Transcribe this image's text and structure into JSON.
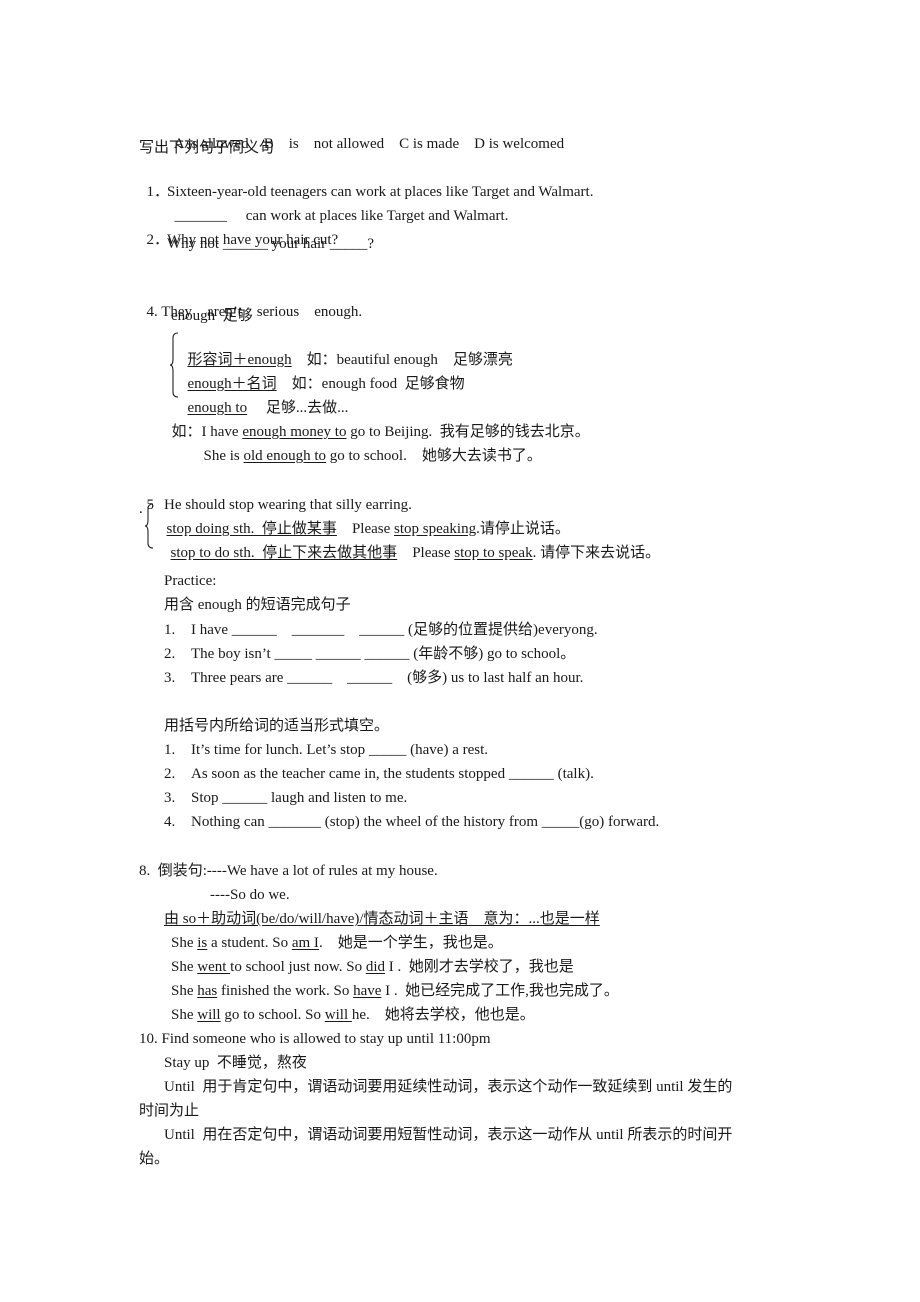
{
  "options_line": {
    "a": "A is allowed",
    "b": "B",
    "b2": "is",
    "b3": "not allowed",
    "c": "C is made",
    "d": "D is welcomed"
  },
  "synonym_section": {
    "heading": "写出下列句子同义句",
    "items": [
      {
        "num": "1．",
        "text": "Sixteen-year-old teenagers can work at places like Target and Walmart.",
        "answer_prefix": "_______",
        "answer": "can work at places like Target and Walmart."
      },
      {
        "num": "2．",
        "text": "Why not have your hair cut?",
        "answer": "Why not ______ your hair _____?"
      }
    ]
  },
  "section4": {
    "title_parts": [
      "4. They",
      "aren’t",
      "serious",
      "enough."
    ],
    "enough_label": "enough  足够",
    "rules": [
      {
        "pattern": "形容词＋enough",
        "example_label": "如：beautiful enough",
        "meaning": "足够漂亮"
      },
      {
        "pattern": "enough＋名词",
        "example_label": "如：enough food",
        "meaning": "足够食物"
      },
      {
        "pattern": "enough to",
        "example_label": "",
        "meaning": "足够...去做..."
      }
    ],
    "example1": {
      "prefix": "如：I have ",
      "underlined": "enough money to",
      "suffix": " go to Beijing.  我有足够的钱去北京。"
    },
    "example2": {
      "prefix": "She is ",
      "underlined": "old enough to",
      "suffix": " go to school.    她够大去读书了。"
    }
  },
  "section5": {
    "title_num": "5",
    "title": "He should stop wearing that silly earring.",
    "rules": [
      {
        "pattern": "stop doing sth.  停止做某事",
        "example_prefix": "Please ",
        "example_underlined": "stop speaking",
        "example_suffix": ".请停止说话。"
      },
      {
        "pattern": "stop to do sth.  停止下来去做其他事",
        "example_prefix": "Please ",
        "example_underlined": "stop to speak",
        "example_suffix": ". 请停下来去说话。"
      }
    ]
  },
  "practice": {
    "heading": "Practice:",
    "instruction1": "用含 enough 的短语完成句子",
    "items1": [
      {
        "num": "1.",
        "text": "I have ______    _______    ______ (足够的位置提供给)everyong."
      },
      {
        "num": "2.",
        "text": "The boy isn’t _____ ______ ______ (年龄不够) go to school。"
      },
      {
        "num": "3.",
        "text": "Three pears are ______    ______    (够多) us to last half an hour."
      }
    ],
    "instruction2": "用括号内所给词的适当形式填空。",
    "items2": [
      {
        "num": "1.",
        "text": "It’s time for lunch. Let’s stop _____ (have) a rest."
      },
      {
        "num": "2.",
        "text": "As soon as the teacher came in, the students stopped ______ (talk)."
      },
      {
        "num": "3.",
        "text": "Stop ______ laugh and listen to me."
      },
      {
        "num": "4.",
        "text": "Nothing can _______ (stop) the wheel of the history from _____(go) forward."
      }
    ]
  },
  "section8": {
    "title": "8.  倒装句:----We have a lot of rules at my house.",
    "reply": "----So do we.",
    "rule": "由 so＋助动词(be/do/will/have)/情态动词＋主语    意为：...也是一样",
    "examples": [
      {
        "p1": "She ",
        "u1": "is",
        "p2": " a student. So ",
        "u2": "am I",
        "p3": ".    她是一个学生，我也是。"
      },
      {
        "p1": "She ",
        "u1": "went ",
        "p2": "to school just now. So ",
        "u2": "did",
        "p3": " I .  她刚才去学校了，我也是"
      },
      {
        "p1": "She ",
        "u1": "has",
        "p2": " finished the work. So ",
        "u2": "have",
        "p3": " I .  她已经完成了工作,我也完成了。"
      },
      {
        "p1": "She ",
        "u1": "will",
        "p2": " go to school. So ",
        "u2": "will ",
        "p3": "he.    她将去学校，他也是。"
      }
    ]
  },
  "section10": {
    "title": "10. Find someone who is allowed to stay up until 11:00pm",
    "stay_up": "Stay up  不睡觉，熬夜",
    "until1_line1": "Until  用于肯定句中，谓语动词要用延续性动词，表示这个动作一致延续到 until 发生的",
    "until1_line2": "时间为止",
    "until2_line1": "Until  用在否定句中，谓语动词要用短暂性动词，表示这一动作从 until 所表示的时间开",
    "until2_line2": "始。"
  }
}
